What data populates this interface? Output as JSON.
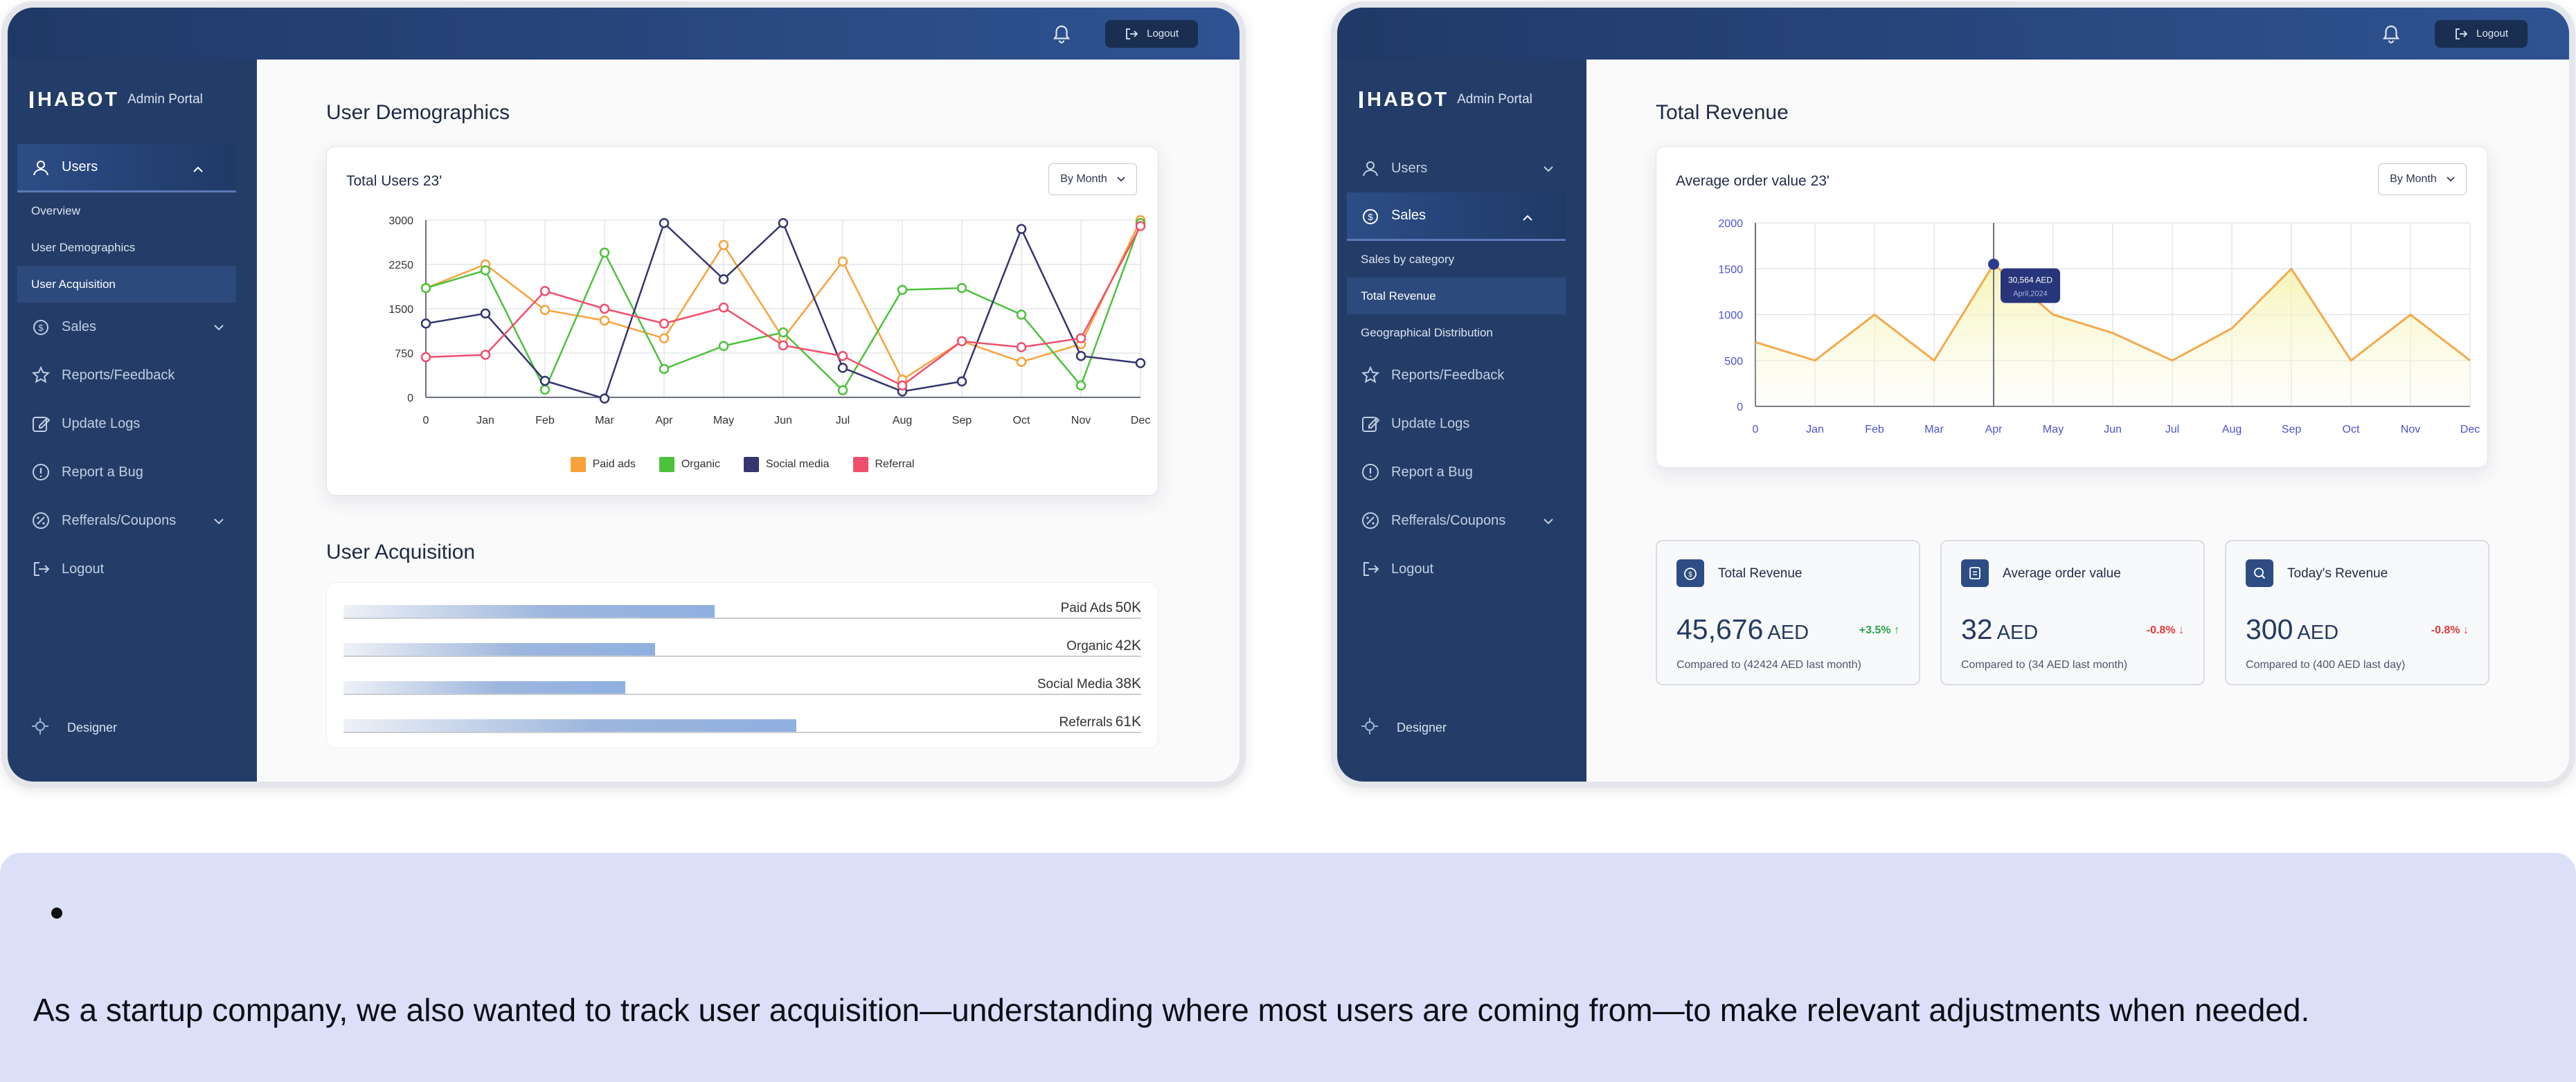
{
  "topbar": {
    "logout_label": "Logout"
  },
  "brand": {
    "logo_text": "HABOT",
    "subtitle": "Admin Portal"
  },
  "sidebar_left": {
    "items": [
      {
        "label": "Users"
      },
      {
        "label": "Sales"
      },
      {
        "label": "Reports/Feedback"
      },
      {
        "label": "Update Logs"
      },
      {
        "label": "Report a Bug"
      },
      {
        "label": "Refferals/Coupons"
      },
      {
        "label": "Logout"
      }
    ],
    "users_sub": [
      {
        "label": "Overview"
      },
      {
        "label": "User Demographics"
      },
      {
        "label": "User Acquisition"
      }
    ],
    "footer": "Designer"
  },
  "sidebar_right": {
    "sales_sub": [
      {
        "label": "Sales by category"
      },
      {
        "label": "Total Revenue"
      },
      {
        "label": "Geographical Distribution"
      }
    ]
  },
  "demographics": {
    "heading": "User Demographics",
    "card_title": "Total Users 23'",
    "dropdown": "By Month",
    "acquisition_heading": "User Acquisition",
    "acquisition": [
      {
        "label": "Paid Ads",
        "value_text": "50K",
        "value": 50
      },
      {
        "label": "Organic",
        "value_text": "42K",
        "value": 42
      },
      {
        "label": "Social Media",
        "value_text": "38K",
        "value": 38
      },
      {
        "label": "Referrals",
        "value_text": "61K",
        "value": 61
      }
    ]
  },
  "revenue": {
    "heading": "Total Revenue",
    "card_title": "Average order value 23'",
    "dropdown": "By Month",
    "tooltip_value": "30,564 AED",
    "tooltip_date": "April,2024",
    "stats": [
      {
        "title": "Total Revenue",
        "value": "45,676",
        "unit": "AED",
        "delta": "+3.5%",
        "delta_dir": "up",
        "compare": "Compared to (42424 AED last month)",
        "icon": "revenue-icon"
      },
      {
        "title": "Average order value",
        "value": "32",
        "unit": "AED",
        "delta": "-0.8%",
        "delta_dir": "down",
        "compare": "Compared to (34 AED last month)",
        "icon": "receipt-icon"
      },
      {
        "title": "Today's Revenue",
        "value": "300",
        "unit": "AED",
        "delta": "-0.8%",
        "delta_dir": "down",
        "compare": "Compared to (400 AED last day)",
        "icon": "money-search-icon"
      }
    ]
  },
  "caption": "As a startup company, we also wanted to track user acquisition—understanding where most users are coming from—to make relevant adjustments when needed.",
  "colors": {
    "paid_ads": "#f7a23b",
    "organic": "#4cc23c",
    "social_media": "#35356f",
    "referral": "#ef4f6d",
    "sidebar": "#243d68",
    "caption_bg": "#dbdff8"
  },
  "chart_data": [
    {
      "type": "line",
      "title": "Total Users 23'",
      "x": [
        "0",
        "Jan",
        "Feb",
        "Mar",
        "Apr",
        "May",
        "Jun",
        "Jul",
        "Aug",
        "Sep",
        "Oct",
        "Nov",
        "Dec"
      ],
      "ylim": [
        0,
        3000
      ],
      "yticks": [
        0,
        750,
        1500,
        2250,
        3000
      ],
      "grid": true,
      "legend_position": "bottom",
      "series": [
        {
          "name": "Paid ads",
          "color": "#f7a23b",
          "values": [
            1850,
            2250,
            1480,
            1300,
            1000,
            2580,
            1000,
            2300,
            300,
            950,
            600,
            900,
            3000
          ]
        },
        {
          "name": "Organic",
          "color": "#4cc23c",
          "values": [
            1850,
            2150,
            130,
            2450,
            480,
            870,
            1100,
            120,
            1820,
            1850,
            1400,
            200,
            2950
          ]
        },
        {
          "name": "Social media",
          "color": "#35356f",
          "values": [
            1250,
            1420,
            280,
            -20,
            2950,
            2000,
            2950,
            500,
            100,
            270,
            2850,
            700,
            580
          ]
        },
        {
          "name": "Referral",
          "color": "#ef4f6d",
          "values": [
            680,
            720,
            1800,
            1500,
            1250,
            1520,
            880,
            700,
            200,
            950,
            850,
            1000,
            2900
          ]
        }
      ]
    },
    {
      "type": "area",
      "title": "Average order value 23'",
      "x": [
        "0",
        "Jan",
        "Feb",
        "Mar",
        "Apr",
        "May",
        "Jun",
        "Jul",
        "Aug",
        "Sep",
        "Oct",
        "Nov",
        "Dec"
      ],
      "ylim": [
        0,
        2000
      ],
      "yticks": [
        0,
        500,
        1000,
        1500,
        2000
      ],
      "grid": true,
      "series": [
        {
          "name": "",
          "color": "#f5a94d",
          "values": [
            700,
            500,
            1000,
            500,
            1550,
            1000,
            800,
            500,
            850,
            1500,
            500,
            1000,
            500
          ]
        }
      ],
      "highlight": {
        "index": 4,
        "label": "30,564 AED",
        "sublabel": "April,2024"
      }
    },
    {
      "type": "bar",
      "title": "User Acquisition",
      "categories": [
        "Paid Ads",
        "Organic",
        "Social Media",
        "Referrals"
      ],
      "values": [
        50,
        42,
        38,
        61
      ]
    }
  ]
}
